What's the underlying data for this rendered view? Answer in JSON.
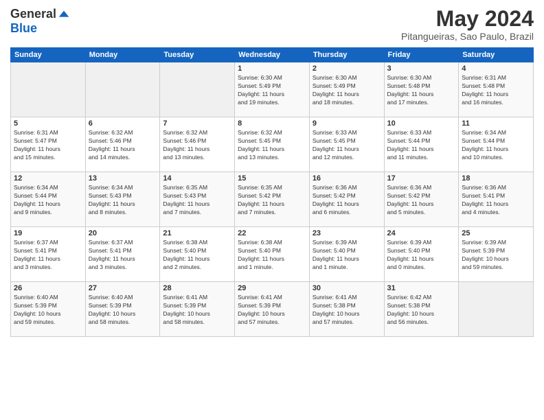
{
  "logo": {
    "general": "General",
    "blue": "Blue"
  },
  "title": "May 2024",
  "subtitle": "Pitangueiras, Sao Paulo, Brazil",
  "weekdays": [
    "Sunday",
    "Monday",
    "Tuesday",
    "Wednesday",
    "Thursday",
    "Friday",
    "Saturday"
  ],
  "weeks": [
    [
      {
        "day": "",
        "info": ""
      },
      {
        "day": "",
        "info": ""
      },
      {
        "day": "",
        "info": ""
      },
      {
        "day": "1",
        "info": "Sunrise: 6:30 AM\nSunset: 5:49 PM\nDaylight: 11 hours\nand 19 minutes."
      },
      {
        "day": "2",
        "info": "Sunrise: 6:30 AM\nSunset: 5:49 PM\nDaylight: 11 hours\nand 18 minutes."
      },
      {
        "day": "3",
        "info": "Sunrise: 6:30 AM\nSunset: 5:48 PM\nDaylight: 11 hours\nand 17 minutes."
      },
      {
        "day": "4",
        "info": "Sunrise: 6:31 AM\nSunset: 5:48 PM\nDaylight: 11 hours\nand 16 minutes."
      }
    ],
    [
      {
        "day": "5",
        "info": "Sunrise: 6:31 AM\nSunset: 5:47 PM\nDaylight: 11 hours\nand 15 minutes."
      },
      {
        "day": "6",
        "info": "Sunrise: 6:32 AM\nSunset: 5:46 PM\nDaylight: 11 hours\nand 14 minutes."
      },
      {
        "day": "7",
        "info": "Sunrise: 6:32 AM\nSunset: 5:46 PM\nDaylight: 11 hours\nand 13 minutes."
      },
      {
        "day": "8",
        "info": "Sunrise: 6:32 AM\nSunset: 5:45 PM\nDaylight: 11 hours\nand 13 minutes."
      },
      {
        "day": "9",
        "info": "Sunrise: 6:33 AM\nSunset: 5:45 PM\nDaylight: 11 hours\nand 12 minutes."
      },
      {
        "day": "10",
        "info": "Sunrise: 6:33 AM\nSunset: 5:44 PM\nDaylight: 11 hours\nand 11 minutes."
      },
      {
        "day": "11",
        "info": "Sunrise: 6:34 AM\nSunset: 5:44 PM\nDaylight: 11 hours\nand 10 minutes."
      }
    ],
    [
      {
        "day": "12",
        "info": "Sunrise: 6:34 AM\nSunset: 5:44 PM\nDaylight: 11 hours\nand 9 minutes."
      },
      {
        "day": "13",
        "info": "Sunrise: 6:34 AM\nSunset: 5:43 PM\nDaylight: 11 hours\nand 8 minutes."
      },
      {
        "day": "14",
        "info": "Sunrise: 6:35 AM\nSunset: 5:43 PM\nDaylight: 11 hours\nand 7 minutes."
      },
      {
        "day": "15",
        "info": "Sunrise: 6:35 AM\nSunset: 5:42 PM\nDaylight: 11 hours\nand 7 minutes."
      },
      {
        "day": "16",
        "info": "Sunrise: 6:36 AM\nSunset: 5:42 PM\nDaylight: 11 hours\nand 6 minutes."
      },
      {
        "day": "17",
        "info": "Sunrise: 6:36 AM\nSunset: 5:42 PM\nDaylight: 11 hours\nand 5 minutes."
      },
      {
        "day": "18",
        "info": "Sunrise: 6:36 AM\nSunset: 5:41 PM\nDaylight: 11 hours\nand 4 minutes."
      }
    ],
    [
      {
        "day": "19",
        "info": "Sunrise: 6:37 AM\nSunset: 5:41 PM\nDaylight: 11 hours\nand 3 minutes."
      },
      {
        "day": "20",
        "info": "Sunrise: 6:37 AM\nSunset: 5:41 PM\nDaylight: 11 hours\nand 3 minutes."
      },
      {
        "day": "21",
        "info": "Sunrise: 6:38 AM\nSunset: 5:40 PM\nDaylight: 11 hours\nand 2 minutes."
      },
      {
        "day": "22",
        "info": "Sunrise: 6:38 AM\nSunset: 5:40 PM\nDaylight: 11 hours\nand 1 minute."
      },
      {
        "day": "23",
        "info": "Sunrise: 6:39 AM\nSunset: 5:40 PM\nDaylight: 11 hours\nand 1 minute."
      },
      {
        "day": "24",
        "info": "Sunrise: 6:39 AM\nSunset: 5:40 PM\nDaylight: 11 hours\nand 0 minutes."
      },
      {
        "day": "25",
        "info": "Sunrise: 6:39 AM\nSunset: 5:39 PM\nDaylight: 10 hours\nand 59 minutes."
      }
    ],
    [
      {
        "day": "26",
        "info": "Sunrise: 6:40 AM\nSunset: 5:39 PM\nDaylight: 10 hours\nand 59 minutes."
      },
      {
        "day": "27",
        "info": "Sunrise: 6:40 AM\nSunset: 5:39 PM\nDaylight: 10 hours\nand 58 minutes."
      },
      {
        "day": "28",
        "info": "Sunrise: 6:41 AM\nSunset: 5:39 PM\nDaylight: 10 hours\nand 58 minutes."
      },
      {
        "day": "29",
        "info": "Sunrise: 6:41 AM\nSunset: 5:39 PM\nDaylight: 10 hours\nand 57 minutes."
      },
      {
        "day": "30",
        "info": "Sunrise: 6:41 AM\nSunset: 5:38 PM\nDaylight: 10 hours\nand 57 minutes."
      },
      {
        "day": "31",
        "info": "Sunrise: 6:42 AM\nSunset: 5:38 PM\nDaylight: 10 hours\nand 56 minutes."
      },
      {
        "day": "",
        "info": ""
      }
    ]
  ]
}
